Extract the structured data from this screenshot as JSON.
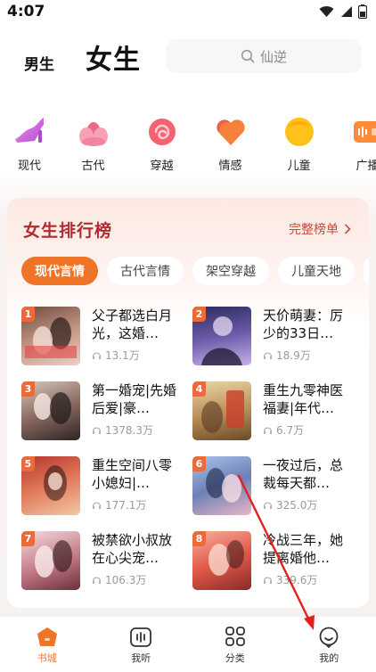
{
  "status": {
    "time": "4:07"
  },
  "header": {
    "tab_male": "男生",
    "tab_female": "女生",
    "search_placeholder": "仙逆"
  },
  "categories": [
    {
      "label": "现代",
      "icon": "high-heel-icon"
    },
    {
      "label": "古代",
      "icon": "lotus-icon"
    },
    {
      "label": "穿越",
      "icon": "swirl-cloud-icon"
    },
    {
      "label": "情感",
      "icon": "heart-icon"
    },
    {
      "label": "儿童",
      "icon": "child-icon"
    },
    {
      "label": "广播",
      "icon": "radio-icon"
    }
  ],
  "ranking": {
    "title": "女生排行榜",
    "more": "完整榜单",
    "tabs": [
      "现代言情",
      "古代言情",
      "架空穿越",
      "儿童天地"
    ],
    "books": [
      {
        "rank": "1",
        "title": "父子都选白月光，这婚…",
        "count": "13.1万"
      },
      {
        "rank": "2",
        "title": "天价萌妻：厉少的33日…",
        "count": "18.9万"
      },
      {
        "rank": "3",
        "title": "第一婚宠|先婚后爱|豪…",
        "count": "1378.3万"
      },
      {
        "rank": "4",
        "title": "重生九零神医福妻|年代…",
        "count": "6.7万"
      },
      {
        "rank": "5",
        "title": "重生空间八零小媳妇|…",
        "count": "177.1万"
      },
      {
        "rank": "6",
        "title": "一夜过后，总裁每天都…",
        "count": "325.0万"
      },
      {
        "rank": "7",
        "title": "被禁欲小叔放在心尖宠…",
        "count": "106.3万"
      },
      {
        "rank": "8",
        "title": "冷战三年，她提离婚他…",
        "count": "339.6万"
      }
    ]
  },
  "nav": [
    {
      "label": "书城",
      "icon": "bookstore-icon",
      "active": true
    },
    {
      "label": "我听",
      "icon": "listen-icon",
      "active": false
    },
    {
      "label": "分类",
      "icon": "category-grid-icon",
      "active": false
    },
    {
      "label": "我的",
      "icon": "profile-icon",
      "active": false
    }
  ],
  "colors": {
    "accent": "#ee7427",
    "title_red": "#b32a31"
  }
}
